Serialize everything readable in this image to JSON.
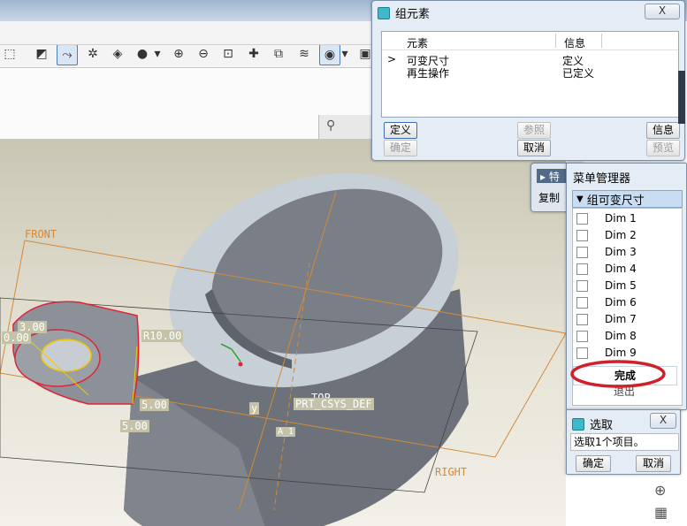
{
  "toolbar": {
    "icons": [
      "spin-center-icon",
      "datum-axis-icon",
      "datum-points-icon",
      "csys-icon",
      "shading-icon",
      "dropdown-icon",
      "zoom-in-icon",
      "zoom-out-icon",
      "refit-icon",
      "annotation-icon",
      "saved-view-icon",
      "layers-icon",
      "display-style-icon",
      "dropdown-icon",
      "repaint-icon"
    ]
  },
  "viewport_labels": {
    "front": "FRONT",
    "top": "TOP",
    "right": "RIGHT",
    "csys": "PRT_CSYS_DEF",
    "dim_r": "R10.00",
    "dim_left": "3.00",
    "dim_left_partial": "0.00",
    "dim_5a": "5.00",
    "dim_5b": "5.00",
    "small_y": "y",
    "small_a": "A_1"
  },
  "group_elements": {
    "title": "组元素",
    "close": "X",
    "col_element": "元素",
    "col_info": "信息",
    "rows": [
      {
        "marker": ">",
        "element": "可变尺寸",
        "info": "定义"
      },
      {
        "marker": "",
        "element": "再生操作",
        "info": "已定义"
      }
    ],
    "btn_define": "定义",
    "btn_reference": "参照",
    "btn_info": "信息",
    "btn_ok": "确定",
    "btn_cancel": "取消",
    "btn_preview": "预览"
  },
  "bg_panel": {
    "tab1": "特",
    "tab2": "复制"
  },
  "menu_manager": {
    "title": "菜单管理器",
    "section": "组可变尺寸",
    "items": [
      "Dim 1",
      "Dim 2",
      "Dim 3",
      "Dim 4",
      "Dim 5",
      "Dim 6",
      "Dim 7",
      "Dim 8",
      "Dim 9"
    ],
    "done": "完成",
    "quit": "退出"
  },
  "select_dialog": {
    "title": "选取",
    "close": "X",
    "message": "选取1个项目。",
    "btn_ok": "确定",
    "btn_cancel": "取消"
  },
  "colors": {
    "highlight_ellipse": "#d0202a",
    "datum_orange": "#d38a3a"
  }
}
